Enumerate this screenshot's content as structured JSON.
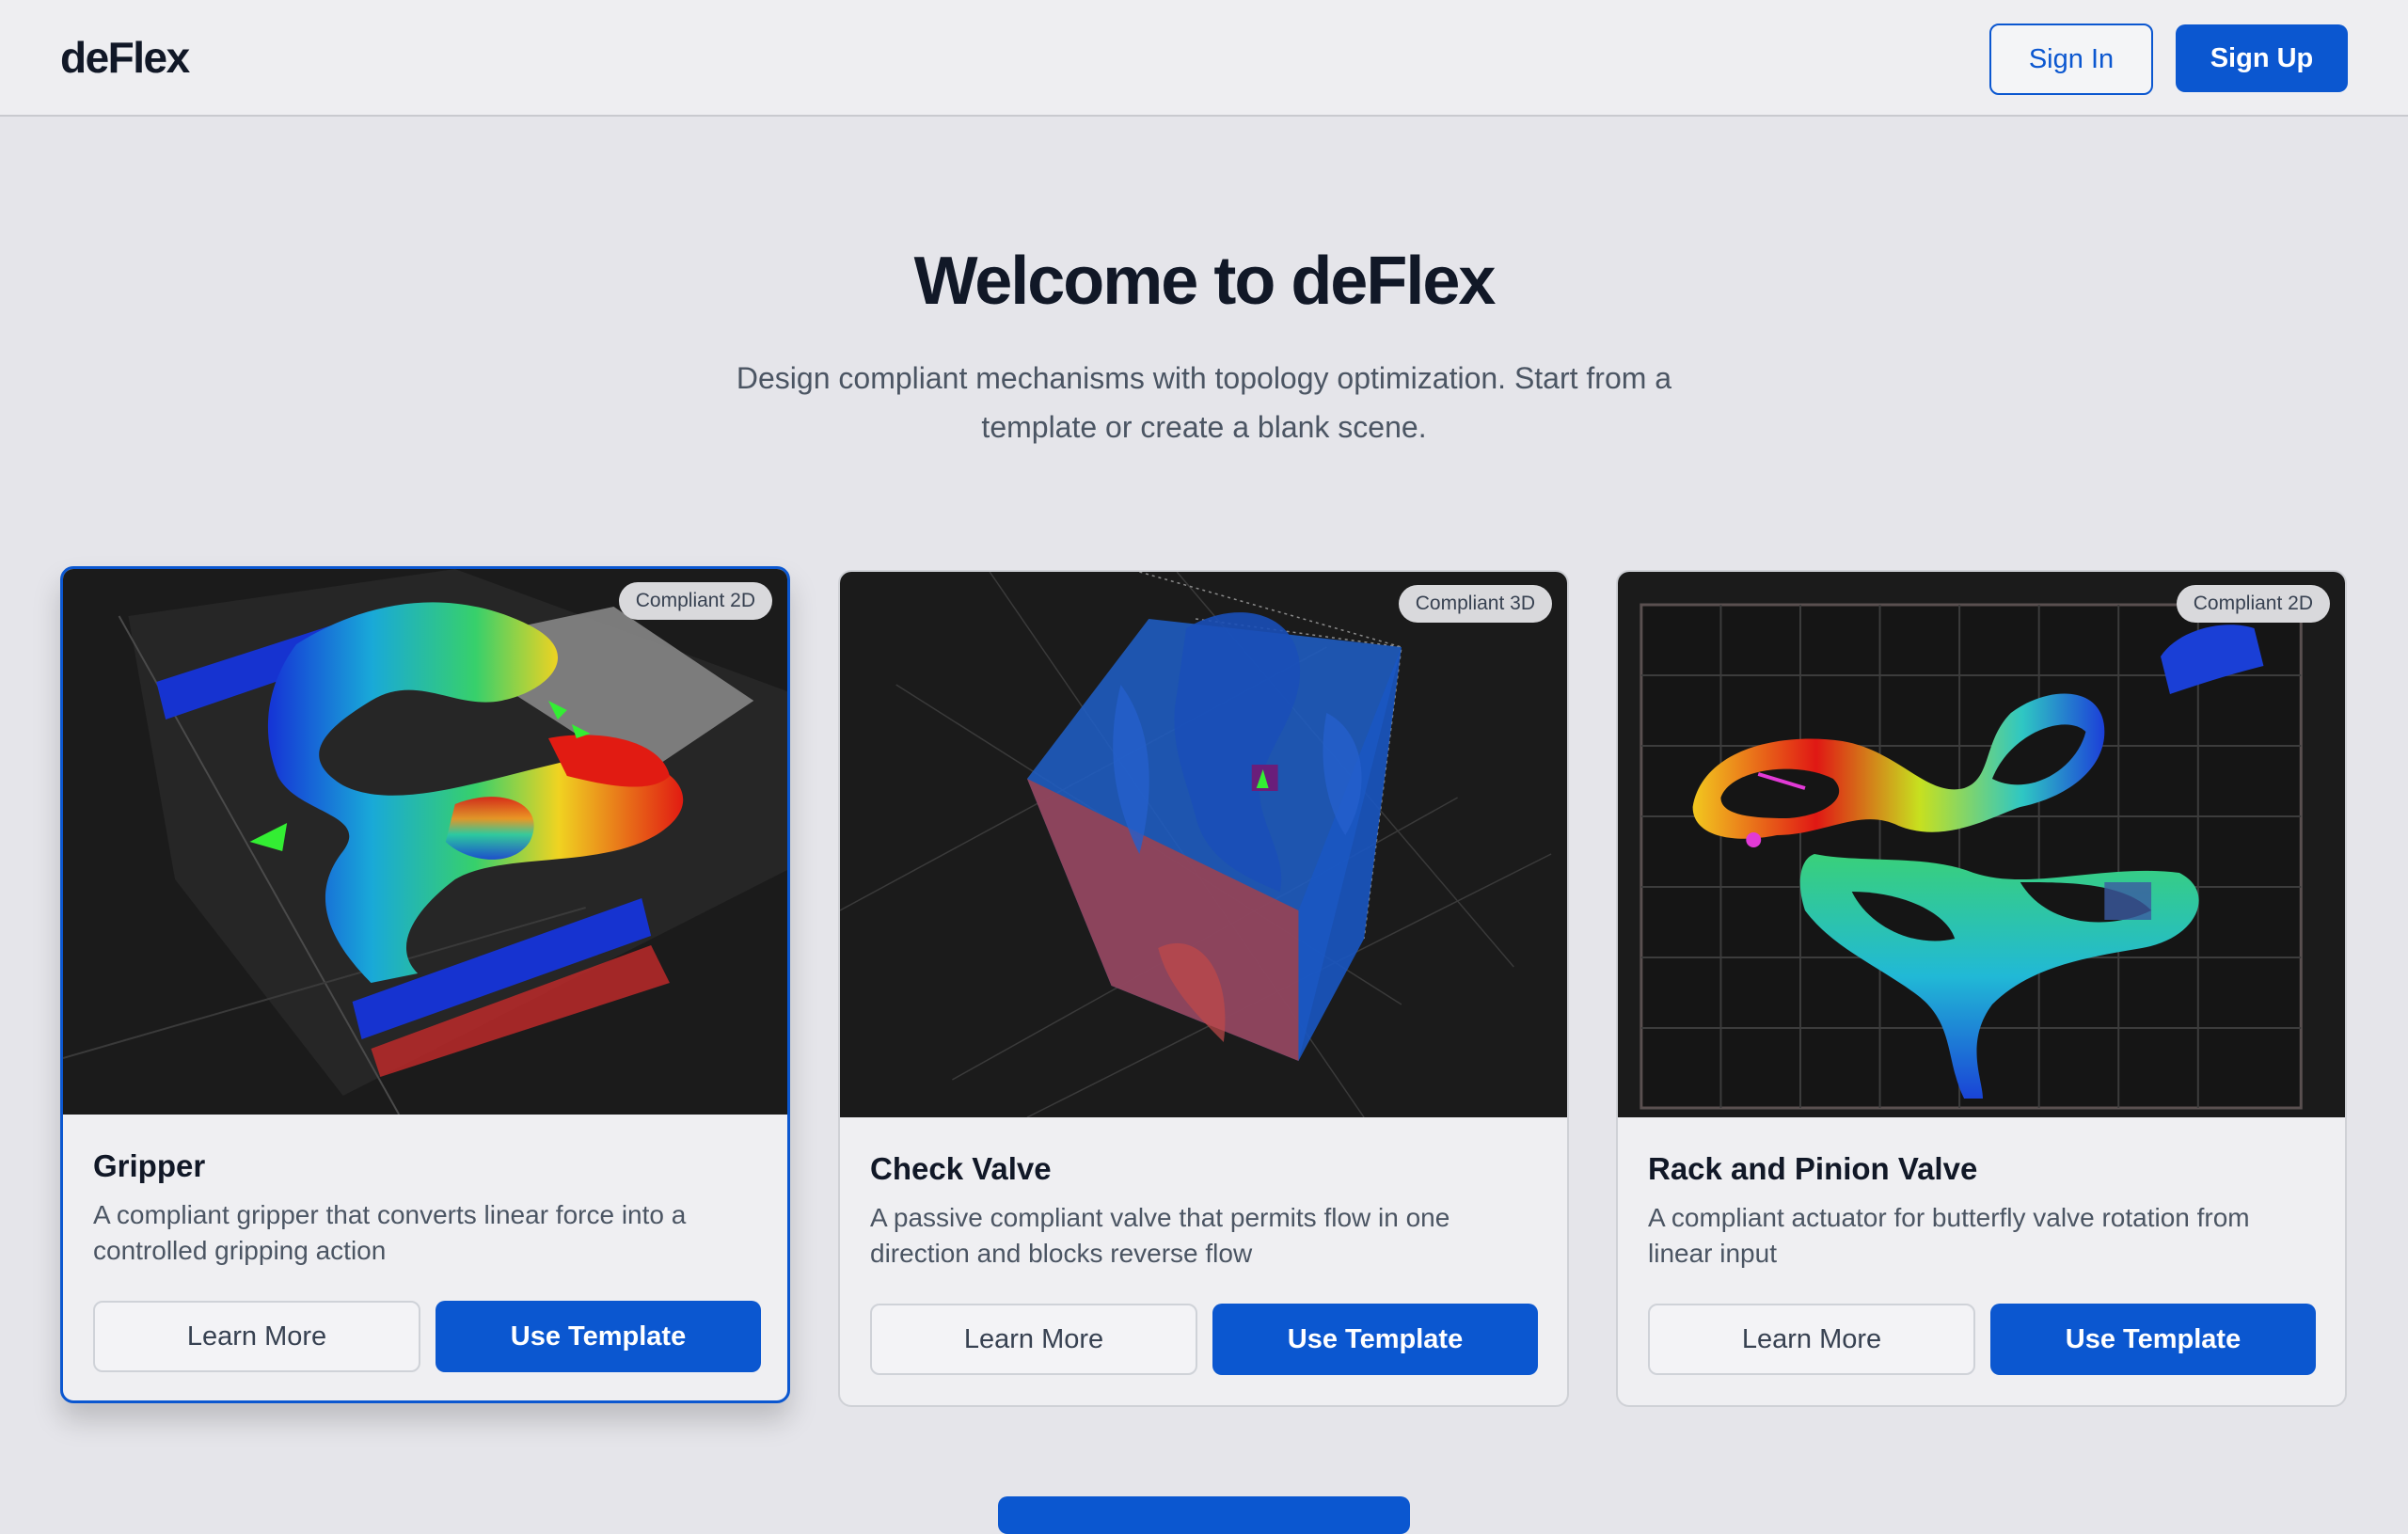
{
  "header": {
    "logo": "deFlex",
    "sign_in": "Sign In",
    "sign_up": "Sign Up"
  },
  "hero": {
    "title": "Welcome to deFlex",
    "subtitle": "Design compliant mechanisms with topology optimization. Start from a template or create a blank scene."
  },
  "templates": [
    {
      "badge": "Compliant 2D",
      "title": "Gripper",
      "description": "A compliant gripper that converts linear force into a controlled gripping action",
      "learn_more": "Learn More",
      "use_template": "Use Template"
    },
    {
      "badge": "Compliant 3D",
      "title": "Check Valve",
      "description": "A passive compliant valve that permits flow in one direction and blocks reverse flow",
      "learn_more": "Learn More",
      "use_template": "Use Template"
    },
    {
      "badge": "Compliant 2D",
      "title": "Rack and Pinion Valve",
      "description": "A compliant actuator for butterfly valve rotation from linear input",
      "learn_more": "Learn More",
      "use_template": "Use Template"
    }
  ],
  "colors": {
    "accent": "#0b57d0",
    "background": "#e5e5ea",
    "render_background": "#1b1b1b"
  }
}
